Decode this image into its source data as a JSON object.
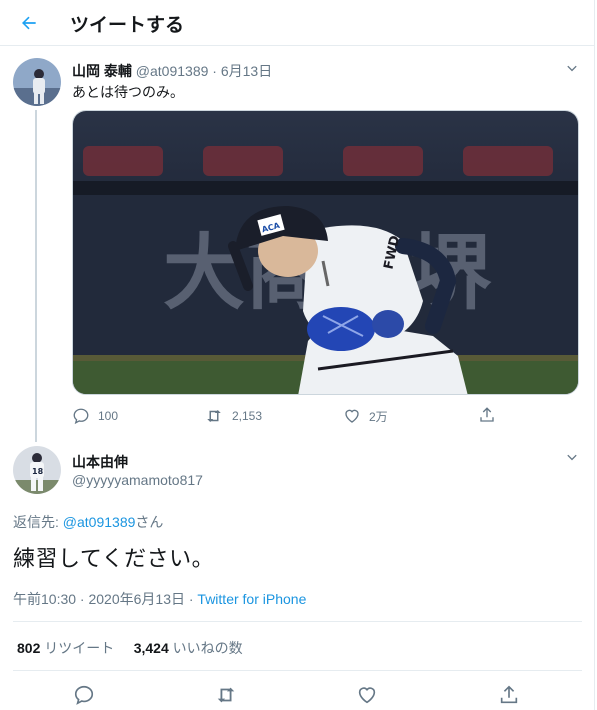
{
  "header": {
    "title": "ツイートする"
  },
  "parent_tweet": {
    "name": "山岡 泰輔",
    "handle": "@at091389",
    "sep": "·",
    "date": "6月13日",
    "text": "あとは待つのみ。",
    "media_jersey_text": "FWD",
    "media_banner_text": "大商大堺",
    "media_cap_logo": "ACA",
    "replies": "100",
    "retweets": "2,153",
    "likes": "2万"
  },
  "reply_tweet": {
    "name": "山本由伸",
    "handle": "@yyyyyamamoto817",
    "avatar_number": "18",
    "reply_prefix": "返信先: ",
    "reply_target": "@at091389",
    "reply_suffix": "さん",
    "text": "練習してください。",
    "time": "午前10:30 · 2020年6月13日 · ",
    "source": "Twitter for iPhone",
    "retweet_count": "802",
    "retweet_label": "リツイート",
    "like_count": "3,424",
    "like_label": "いいねの数"
  },
  "colors": {
    "accent": "#1da1f2",
    "link": "#1b95e0",
    "muted": "#657786"
  }
}
